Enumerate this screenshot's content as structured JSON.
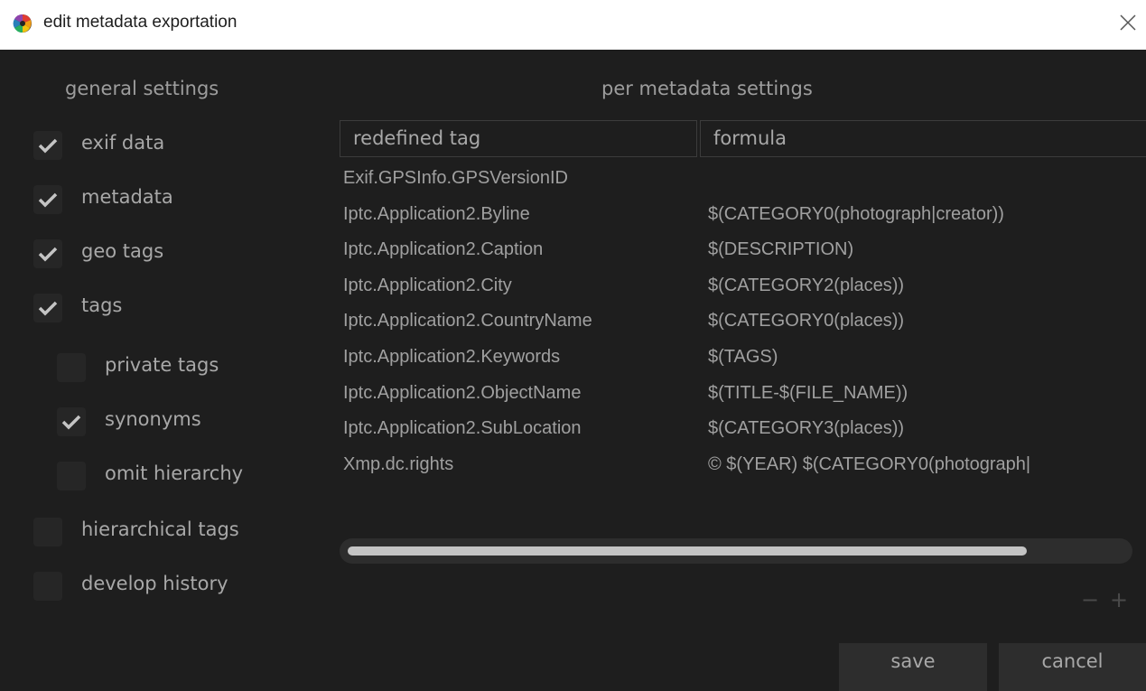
{
  "window": {
    "title": "edit metadata exportation",
    "close_glyph": "✕"
  },
  "general": {
    "heading": "general settings",
    "options": [
      {
        "label": "exif data",
        "checked": true
      },
      {
        "label": "metadata",
        "checked": true
      },
      {
        "label": "geo tags",
        "checked": true
      },
      {
        "label": "tags",
        "checked": true
      },
      {
        "label": "private tags",
        "checked": false
      },
      {
        "label": "synonyms",
        "checked": true
      },
      {
        "label": "omit hierarchy",
        "checked": false
      },
      {
        "label": "hierarchical tags",
        "checked": false
      },
      {
        "label": "develop history",
        "checked": false
      }
    ]
  },
  "per_metadata": {
    "heading": "per metadata settings",
    "columns": [
      "redefined tag",
      "formula"
    ],
    "rows": [
      {
        "tag": "Exif.GPSInfo.GPSVersionID",
        "formula": ""
      },
      {
        "tag": "Iptc.Application2.Byline",
        "formula": "$(CATEGORY0(photograph|creator))"
      },
      {
        "tag": "Iptc.Application2.Caption",
        "formula": "$(DESCRIPTION)"
      },
      {
        "tag": "Iptc.Application2.City",
        "formula": "$(CATEGORY2(places))"
      },
      {
        "tag": "Iptc.Application2.CountryName",
        "formula": "$(CATEGORY0(places))"
      },
      {
        "tag": "Iptc.Application2.Keywords",
        "formula": "$(TAGS)"
      },
      {
        "tag": "Iptc.Application2.ObjectName",
        "formula": "$(TITLE-$(FILE_NAME))"
      },
      {
        "tag": "Iptc.Application2.SubLocation",
        "formula": "$(CATEGORY3(places))"
      },
      {
        "tag": "Xmp.dc.rights",
        "formula": "© $(YEAR) $(CATEGORY0(photograph|"
      }
    ],
    "remove_label": "−",
    "add_label": "+"
  },
  "buttons": {
    "save": "save",
    "cancel": "cancel"
  },
  "colors": {
    "background": "#1e1e1e",
    "checkbox": "#262626",
    "text": "#a8a8a8",
    "button": "#2d2d2d"
  }
}
